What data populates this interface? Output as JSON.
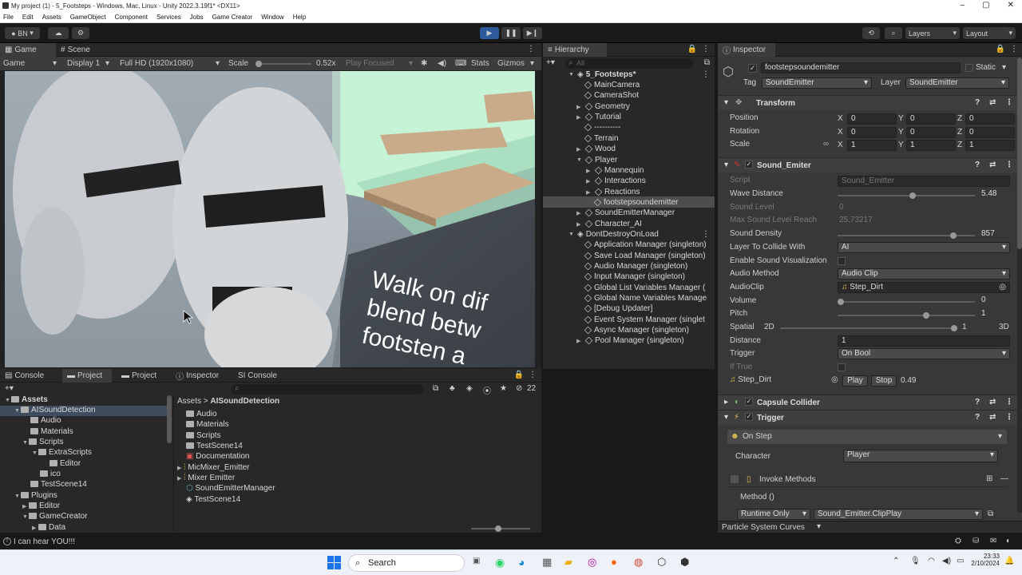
{
  "window": {
    "title": "My project (1) - 5_Footsteps - Windows, Mac, Linux - Unity 2022.3.19f1* <DX11>"
  },
  "menu": [
    "File",
    "Edit",
    "Assets",
    "GameObject",
    "Component",
    "Services",
    "Jobs",
    "Game Creator",
    "Window",
    "Help"
  ],
  "toolbar": {
    "account": "BN",
    "layers": "Layers",
    "layout": "Layout"
  },
  "game": {
    "tabs": [
      "Game",
      "Scene"
    ],
    "mode": "Game",
    "display": "Display 1",
    "resolution": "Full HD (1920x1080)",
    "scale_label": "Scale",
    "scale_value": "0.52x",
    "play_focused": "Play Focused",
    "stats": "Stats",
    "gizmos": "Gizmos",
    "world_text": [
      "Walk on dif",
      "blend betw",
      "footsten a"
    ]
  },
  "hierarchy": {
    "title": "Hierarchy",
    "search_placeholder": "All",
    "items": [
      {
        "label": "5_Footsteps*"
      },
      {
        "label": "MainCamera"
      },
      {
        "label": "CameraShot"
      },
      {
        "label": "Geometry"
      },
      {
        "label": "Tutorial"
      },
      {
        "label": "----------"
      },
      {
        "label": "Terrain"
      },
      {
        "label": "Wood"
      },
      {
        "label": "Player"
      },
      {
        "label": "Mannequin"
      },
      {
        "label": "Interactions"
      },
      {
        "label": "Reactions"
      },
      {
        "label": "footstepsoundemitter"
      },
      {
        "label": "SoundEmitterManager"
      },
      {
        "label": "Character_AI"
      },
      {
        "label": "DontDestroyOnLoad"
      },
      {
        "label": "Application Manager (singleton)"
      },
      {
        "label": "Save Load Manager (singleton)"
      },
      {
        "label": "Audio Manager (singleton)"
      },
      {
        "label": "Input Manager (singleton)"
      },
      {
        "label": "Global List Variables Manager ("
      },
      {
        "label": "Global Name Variables Manage"
      },
      {
        "label": "[Debug Updater]"
      },
      {
        "label": "Event System Manager (singlet"
      },
      {
        "label": "Async Manager (singleton)"
      },
      {
        "label": "Pool Manager (singleton)"
      }
    ]
  },
  "inspector": {
    "title": "Inspector",
    "object_name": "footstepsoundemitter",
    "static": "Static",
    "tag_label": "Tag",
    "tag": "SoundEmitter",
    "layer_label": "Layer",
    "layer": "SoundEmitter",
    "transform": {
      "title": "Transform",
      "position_label": "Position",
      "rotation_label": "Rotation",
      "scale_label": "Scale",
      "position": [
        "0",
        "0",
        "0"
      ],
      "rotation": [
        "0",
        "0",
        "0"
      ],
      "scale": [
        "1",
        "1",
        "1"
      ],
      "axis": [
        "X",
        "Y",
        "Z"
      ]
    },
    "sound_emitter": {
      "title": "Sound_Emiter",
      "script_label": "Script",
      "script": "Sound_Emitter",
      "wave_distance_label": "Wave Distance",
      "wave_distance": "5.48",
      "wave_distance_fill": 0.55,
      "sound_level_label": "Sound Level",
      "sound_level": "0",
      "max_sound_label": "Max Sound Level Reach",
      "max_sound": "25.73217",
      "density_label": "Sound Density",
      "density": "857",
      "density_fill": 0.86,
      "layer_collide_label": "Layer To Collide With",
      "layer_collide": "AI",
      "visualization_label": "Enable Sound Visualization",
      "audio_method_label": "Audio Method",
      "audio_method": "Audio Clip",
      "audioclip_label": "AudioClip",
      "audioclip": "Step_Dirt",
      "volume_label": "Volume",
      "volume": "0",
      "volume_fill": 0.0,
      "pitch_label": "Pitch",
      "pitch": "1",
      "pitch_fill": 0.65,
      "spatial_label": "Spatial",
      "spatial_2d": "2D",
      "spatial_3d": "3D",
      "spatial": "1",
      "spatial_fill": 1.0,
      "distance_label": "Distance",
      "distance": "1",
      "trigger_label": "Trigger",
      "trigger": "On Bool",
      "if_true_label": "If True",
      "clip": "Step_Dirt",
      "play": "Play",
      "stop": "Stop",
      "clip_time": "0.49"
    },
    "capsule": {
      "title": "Capsule Collider"
    },
    "trigger_comp": {
      "title": "Trigger",
      "event": "On Step",
      "character_label": "Character",
      "character": "Player",
      "invoke": "Invoke Methods",
      "method_label": "Method ()",
      "runtime": "Runtime Only",
      "method": "Sound_Emitter.ClipPlay"
    },
    "footer": "Particle System Curves"
  },
  "bottom": {
    "tabs": [
      "Console",
      "Project",
      "Project",
      "Inspector",
      "SI Console"
    ],
    "count": "22",
    "breadcrumb": [
      "Assets",
      "AISoundDetection"
    ],
    "tree": [
      {
        "label": "Assets"
      },
      {
        "label": "AISoundDetection"
      },
      {
        "label": "Audio"
      },
      {
        "label": "Materials"
      },
      {
        "label": "Scripts"
      },
      {
        "label": "ExtraScripts"
      },
      {
        "label": "Editor"
      },
      {
        "label": "ico"
      },
      {
        "label": "TestScene14"
      },
      {
        "label": "Plugins"
      },
      {
        "label": "Editor"
      },
      {
        "label": "GameCreator"
      },
      {
        "label": "Data"
      }
    ],
    "files": [
      "Audio",
      "Materials",
      "Scripts",
      "TestScene14",
      "Documentation",
      "MicMixer_Emitter",
      "Mixer Emitter",
      "SoundEmitterManager",
      "TestScene14"
    ]
  },
  "status": "I can hear YOU!!!",
  "taskbar": {
    "search": "Search",
    "time": "23:33",
    "date": "2/10/2024"
  }
}
